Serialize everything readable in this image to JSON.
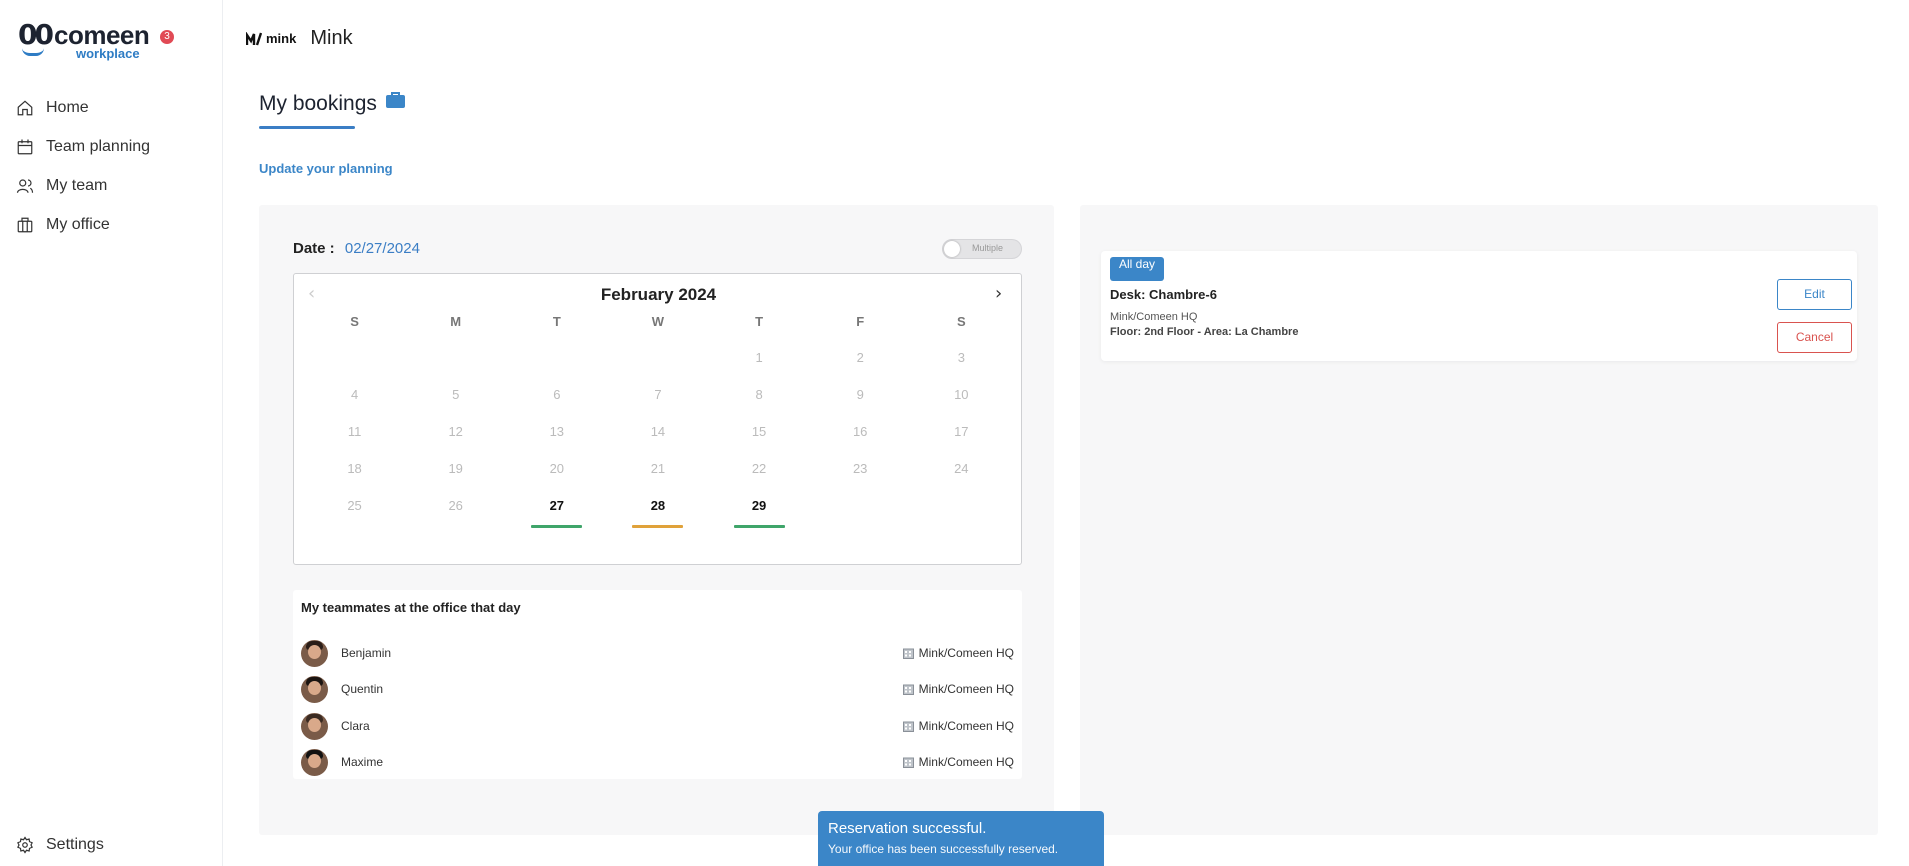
{
  "brand": {
    "logo_word": "comeen",
    "logo_sub": "workplace",
    "notification_count": "3",
    "org_short": "mink",
    "org_name": "Mink"
  },
  "sidebar": {
    "items": [
      {
        "label": "Home",
        "icon": "home-icon"
      },
      {
        "label": "Team planning",
        "icon": "calendar-icon"
      },
      {
        "label": "My team",
        "icon": "users-icon"
      },
      {
        "label": "My office",
        "icon": "building-icon"
      }
    ],
    "settings_label": "Settings"
  },
  "page": {
    "title": "My bookings",
    "update_link": "Update your planning"
  },
  "date_selector": {
    "label": "Date :",
    "value": "02/27/2024",
    "toggle_label": "Multiple",
    "toggle_on": false
  },
  "calendar": {
    "month": "February 2024",
    "weekdays": [
      "S",
      "M",
      "T",
      "W",
      "T",
      "F",
      "S"
    ],
    "weeks": [
      [
        "",
        "",
        "",
        "",
        "1",
        "2",
        "3"
      ],
      [
        "4",
        "5",
        "6",
        "7",
        "8",
        "9",
        "10"
      ],
      [
        "11",
        "12",
        "13",
        "14",
        "15",
        "16",
        "17"
      ],
      [
        "18",
        "19",
        "20",
        "21",
        "22",
        "23",
        "24"
      ],
      [
        "25",
        "26",
        "27",
        "28",
        "29",
        "",
        ""
      ]
    ],
    "active_days": {
      "27": "#3fa56a",
      "28": "#e0a23a",
      "29": "#3fa56a"
    }
  },
  "teammates": {
    "title": "My teammates at the office that day",
    "list": [
      {
        "name": "Benjamin",
        "office": "Mink/Comeen HQ"
      },
      {
        "name": "Quentin",
        "office": "Mink/Comeen HQ"
      },
      {
        "name": "Clara",
        "office": "Mink/Comeen HQ"
      },
      {
        "name": "Maxime",
        "office": "Mink/Comeen HQ"
      }
    ]
  },
  "booking": {
    "badge": "All day",
    "desk": "Desk: Chambre-6",
    "location": "Mink/Comeen HQ",
    "floor": "Floor: 2nd Floor - Area: La Chambre",
    "edit_label": "Edit",
    "cancel_label": "Cancel"
  },
  "toast": {
    "title": "Reservation successful.",
    "message": "Your office has been successfully reserved."
  },
  "colors": {
    "accent": "#3b86c8",
    "danger": "#d9534f",
    "badge": "#e14a55"
  }
}
